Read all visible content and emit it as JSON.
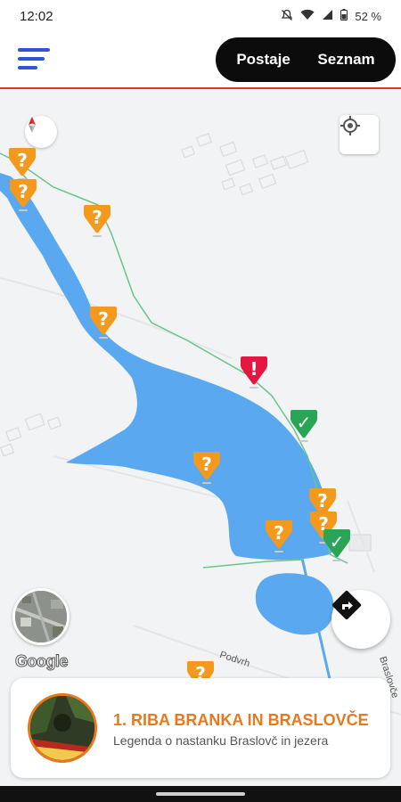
{
  "status_bar": {
    "time": "12:02",
    "battery": "52 %",
    "icons": [
      "notifications-off-icon",
      "wifi-icon",
      "signal-icon",
      "battery-icon"
    ]
  },
  "app_bar": {
    "menu_icon": "hamburger-menu-icon",
    "toggle": {
      "stations_label": "Postaje",
      "list_label": "Seznam"
    }
  },
  "map": {
    "road_labels": {
      "podvrh": "Podvrh",
      "braslovce": "Braslovče"
    },
    "google_logo": "Google",
    "markers": [
      {
        "status": "unknown",
        "glyph": "?"
      },
      {
        "status": "unknown",
        "glyph": "?"
      },
      {
        "status": "unknown",
        "glyph": "?"
      },
      {
        "status": "unknown",
        "glyph": "?"
      },
      {
        "status": "alert",
        "glyph": "!"
      },
      {
        "status": "done",
        "glyph": "✓"
      },
      {
        "status": "unknown",
        "glyph": "?"
      },
      {
        "status": "unknown",
        "glyph": "?"
      },
      {
        "status": "unknown",
        "glyph": "?"
      },
      {
        "status": "unknown",
        "glyph": "?"
      },
      {
        "status": "done",
        "glyph": "✓"
      },
      {
        "status": "unknown",
        "glyph": "?"
      }
    ],
    "colors": {
      "water": "#5aa9f0",
      "unknown": "#f39a1e",
      "alert": "#e5163f",
      "done": "#2aa457",
      "trail": "#6bc48a"
    }
  },
  "card": {
    "title": "1. RIBA BRANKA IN BRASLOVČE",
    "subtitle": "Legenda o nastanku Braslovč in jezera",
    "accent": "#e8781e"
  }
}
